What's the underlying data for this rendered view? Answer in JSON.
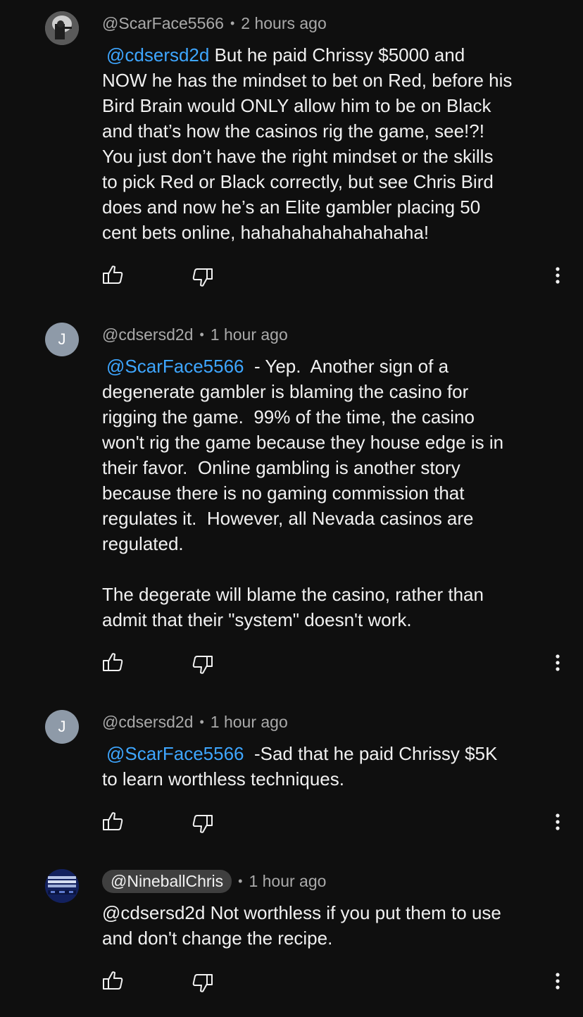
{
  "comments": [
    {
      "author": "@ScarFace5566",
      "time": "2 hours ago",
      "mention": "@cdsersd2d",
      "text": " But he paid Chrissy $5000 and\nNOW he has the mindset to bet on Red, before his\nBird Brain would ONLY allow him to be on Black\nand that’s how the casinos rig the game, see!?!\nYou just don’t have the right mindset or the skills\nto pick Red or Black correctly, but see Chris Bird\ndoes and now he’s an Elite gambler placing 50\ncent bets online, hahahahahahahahaha!"
    },
    {
      "author": "@cdsersd2d",
      "avatar_letter": "J",
      "time": "1 hour ago",
      "mention": "@ScarFace5566",
      "text": "  - Yep.  Another sign of a\ndegenerate gambler is blaming the casino for\nrigging the game.  99% of the time, the casino\nwon't rig the game because they house edge is in\ntheir favor.  Online gambling is another story\nbecause there is no gaming commission that\nregulates it.  However, all Nevada casinos are\nregulated.\n\nThe degerate will blame the casino, rather than\nadmit that their \"system\" doesn't work."
    },
    {
      "author": "@cdsersd2d",
      "avatar_letter": "J",
      "time": "1 hour ago",
      "mention": "@ScarFace5566",
      "text": "  -Sad that he paid Chrissy $5K\nto learn worthless techniques."
    },
    {
      "author": "@NineballChris",
      "time": "1 hour ago",
      "text": "@cdsersd2d Not worthless if you put them to use\nand don't change the recipe."
    }
  ],
  "separator": "•",
  "icons": {
    "like": "thumbs-up-icon",
    "dislike": "thumbs-down-icon",
    "more": "more-vert-icon"
  },
  "colors": {
    "background": "#0f0f0f",
    "text": "#f1f1f1",
    "meta": "#aaaaaa",
    "mention": "#3ea6ff",
    "creator_pill": "#3f3f3f",
    "letter_avatar": "#8e9aa8"
  }
}
